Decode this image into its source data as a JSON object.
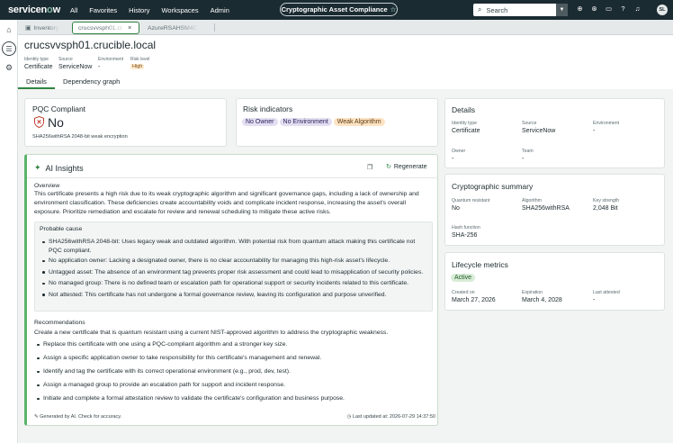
{
  "nav": {
    "logo_a": "servicen",
    "logo_o": "o",
    "logo_b": "w",
    "links": [
      "All",
      "Favorites",
      "History",
      "Workspaces",
      "Admin"
    ],
    "pill_title": "Cryptographic Asset Compliance",
    "pill_star": "☆",
    "search_placeholder": "Search",
    "avatar": "SL"
  },
  "tabs": [
    {
      "label": "Inventory"
    },
    {
      "label": "crucsvvsph01.cr",
      "close": "×"
    },
    {
      "label": "AzureRSAHSM4C"
    }
  ],
  "record": {
    "title": "crucsvvsph01.crucible.local",
    "fields": [
      {
        "key": "Identity type",
        "value": "Certificate"
      },
      {
        "key": "Source",
        "value": "ServiceNow"
      },
      {
        "key": "Environment",
        "value": "-"
      },
      {
        "key": "Risk level",
        "value": "High"
      }
    ],
    "subtabs": [
      "Details",
      "Dependency graph"
    ]
  },
  "pqc": {
    "title": "PQC Compliant",
    "value": "No",
    "note": "SHA256withRSA 2048-bit weak encryption"
  },
  "risk": {
    "title": "Risk indicators",
    "pills": [
      {
        "label": "No Owner",
        "tone": "purple"
      },
      {
        "label": "No Environment",
        "tone": "purple"
      },
      {
        "label": "Weak Algorithm",
        "tone": "orange"
      }
    ]
  },
  "ai": {
    "title": "AI Insights",
    "regenerate": "Regenerate",
    "overview_title": "Overview",
    "overview_lines": [
      "This certificate presents a high risk due to its weak cryptographic algorithm and significant governance gaps, including a lack of ownership and",
      "environment classification. These deficiencies create accountability voids and complicate incident response, increasing the asset's overall",
      "exposure. Prioritize remediation and escalate for review and renewal scheduling to mitigate these active risks."
    ],
    "probable_title": "Probable cause",
    "probable": [
      {
        "l1": "SHA256withRSA 2048-bit: Uses legacy weak and outdated algorithm. With potential risk from quantum attack making this certificate not",
        "l2": "PQC compliant."
      },
      {
        "l1": "No application owner: Lacking a designated owner, there is no clear accountability for managing this high-risk asset's lifecycle.",
        "l2": ""
      },
      {
        "l1": "Untagged asset: The absence of an environment tag prevents proper risk assessment and could lead to misapplication of security policies.",
        "l2": ""
      },
      {
        "l1": "No managed group: There is no defined team or escalation path for operational support or security incidents related to this certificate.",
        "l2": ""
      },
      {
        "l1": "Not attested: This certificate has not undergone a formal governance review, leaving its configuration and purpose unverified.",
        "l2": ""
      }
    ],
    "rec_title": "Recommendations",
    "rec_intro": "Create a new certificate that is quantum resistant using a current NIST-approved algorithm to address the cryptographic weakness.",
    "recs": [
      "Replace this certificate with one using a PQC-compliant algorithm and a stronger key size.",
      "Assign a specific application owner to take responsibility for this certificate's management and renewal.",
      "Identify and tag the certificate with its correct operational environment (e.g., prod, dev, test).",
      "Assign a managed group to provide an escalation path for support and incident response.",
      "Initiate and complete a formal attestation review to validate the certificate's configuration and business purpose."
    ],
    "footer_left": "Generated by AI. Check for accuracy.",
    "footer_right": "Last updated at: 2026-07-29 14:37:50"
  },
  "details": {
    "title": "Details",
    "row1": [
      {
        "key": "Identity type",
        "value": "Certificate"
      },
      {
        "key": "Source",
        "value": "ServiceNow"
      },
      {
        "key": "Environment",
        "value": "-"
      }
    ],
    "row2": [
      {
        "key": "Owner",
        "value": "-"
      },
      {
        "key": "Team",
        "value": "-"
      }
    ]
  },
  "crypto": {
    "title": "Cryptographic summary",
    "row1": [
      {
        "key": "Quantum resistant",
        "value": "No"
      },
      {
        "key": "Algorithm",
        "value": "SHA256withRSA"
      },
      {
        "key": "Key strength",
        "value": "2,048 Bit"
      }
    ],
    "hash_key": "Hash function",
    "hash_value": "SHA-256"
  },
  "lifecycle": {
    "title": "Lifecycle metrics",
    "status": "Active",
    "row": [
      {
        "key": "Created on",
        "value": "March 27, 2026"
      },
      {
        "key": "Expiration",
        "value": "March 4, 2028"
      },
      {
        "key": "Last attested",
        "value": "-"
      }
    ]
  },
  "colors": {
    "nav_bg": "#1b2b32",
    "accent_green": "#2e8540",
    "danger_red": "#c0392b"
  }
}
